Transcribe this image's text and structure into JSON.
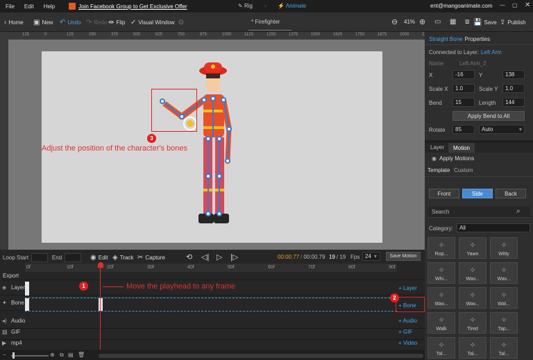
{
  "menubar": {
    "file": "File",
    "edit": "Edit",
    "help": "Help",
    "promo": "Join Facebook Group to Get Exclusive Offer",
    "rig": "Rig",
    "animate": "Animate",
    "email": "ent@mangoanimate.com"
  },
  "toolbar": {
    "home": "Home",
    "new": "New",
    "undo": "Undo",
    "redo": "Redo",
    "flip": "Flip",
    "visual_window": "Visual Window",
    "doc_title": "* Firefighter",
    "zoom": "41%",
    "save": "Save",
    "publish": "Publish"
  },
  "ruler": {
    "labels": [
      "125",
      "0",
      "125",
      "250",
      "375",
      "500",
      "625",
      "750",
      "875",
      "1000",
      "1125",
      "1250",
      "1375",
      "1500",
      "1625",
      "1750",
      "1875",
      "2000",
      "2125"
    ]
  },
  "annotations": {
    "step3_badge": "3",
    "step3_text": "Adjust the position of the character's bones",
    "step1_badge": "1",
    "step1_text": "Move the playhead to any frame",
    "step2_badge": "2"
  },
  "timeline": {
    "loop_start": "Loop Start",
    "end": "End",
    "edit": "Edit",
    "track": "Track",
    "capture": "Capture",
    "current_time": "00:00.77",
    "total_time": "00:00.79",
    "frame": "19",
    "frame_total": "/ 19",
    "fps_label": "Fps",
    "fps_value": "24",
    "save_motion": "Save Motion",
    "frame_labels": [
      "0f",
      "10f",
      "20f",
      "30f",
      "40f",
      "50f",
      "60f",
      "70f",
      "80f",
      "90f"
    ],
    "rows": [
      "Export",
      "Layer",
      "Bone",
      "Audio",
      "GIF",
      "mp4"
    ],
    "add": {
      "layer": "Layer",
      "bone": "Bone",
      "audio": "Audio",
      "gif": "GIF",
      "video": "Video"
    }
  },
  "properties": {
    "title_prefix": "Straight Bone",
    "title_suffix": "Properties",
    "connected_label": "Connected to Layer:",
    "connected_value": "Left Arm",
    "name_label": "Name",
    "name_value": "Left Arm_2",
    "x_label": "X",
    "x_value": "-16",
    "y_label": "Y",
    "y_value": "138",
    "scalex_label": "Scale X",
    "scalex_value": "1.0",
    "scaley_label": "Scale Y",
    "scaley_value": "1.0",
    "bend_label": "Bend",
    "bend_value": "15",
    "length_label": "Length",
    "length_value": "144",
    "apply_bend": "Apply Bend to All",
    "rotate_label": "Rotate",
    "rotate_value": "85",
    "rotate_mode": "Auto"
  },
  "motion_panel": {
    "tab_layer": "Layer",
    "tab_motion": "Motion",
    "apply_motions": "Apply Motions",
    "sub_template": "Template",
    "sub_custom": "Custom",
    "view_front": "Front",
    "view_side": "Side",
    "view_back": "Back",
    "search_placeholder": "Search",
    "category_label": "Category:",
    "category_value": "All",
    "items": [
      "Rop...",
      "Yawn",
      "Witty",
      "Whi...",
      "Wav...",
      "Wav...",
      "Wav...",
      "Wav...",
      "Wal...",
      "Walk",
      "Tired",
      "Tap...",
      "Tal...",
      "Tal...",
      "Tal..."
    ]
  },
  "colors": {
    "accent": "#4aa3e8",
    "annotation_red": "#e02020",
    "playhead": "#e03030"
  }
}
